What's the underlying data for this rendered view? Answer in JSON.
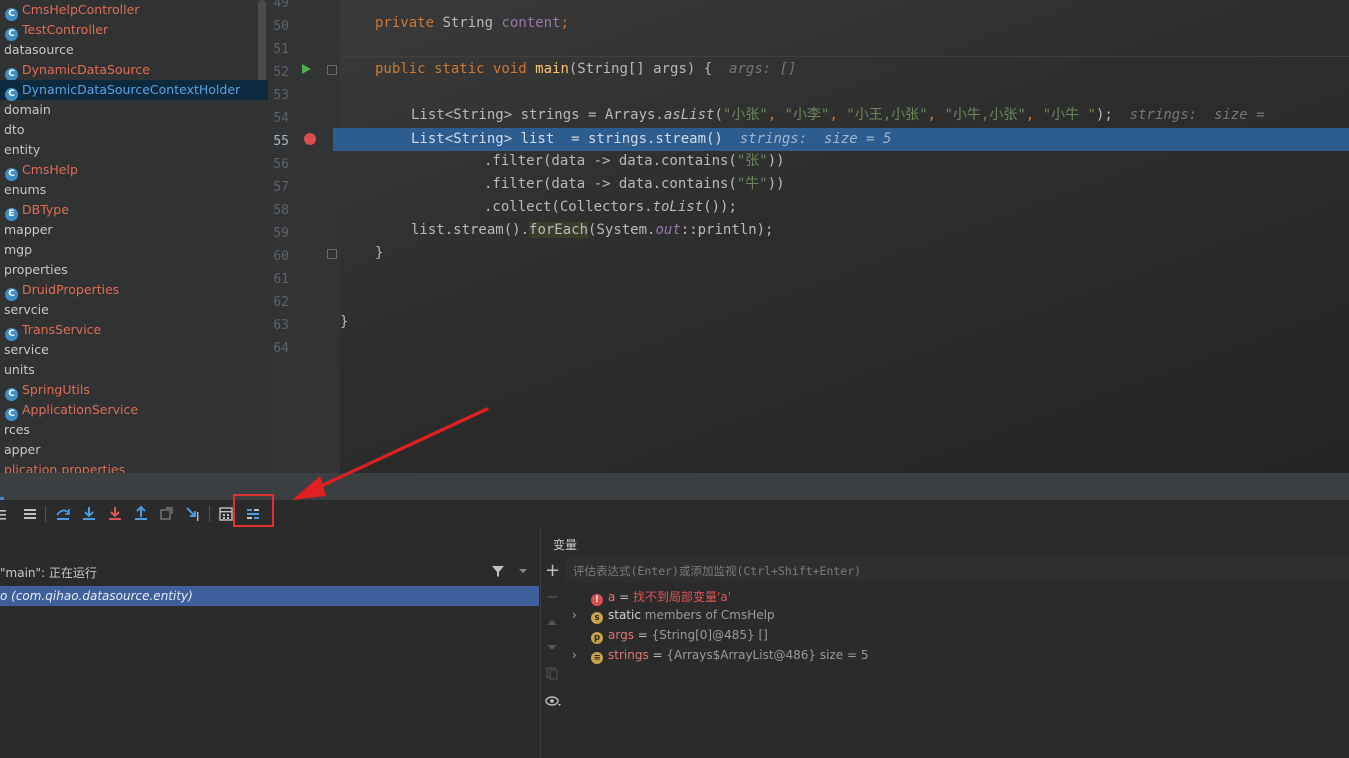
{
  "project_tree": {
    "items": [
      {
        "label": "CmsHelpController",
        "kind": "class",
        "icon": "class-icon"
      },
      {
        "label": "TestController",
        "kind": "class",
        "icon": "class-icon"
      },
      {
        "label": "datasource",
        "kind": "package"
      },
      {
        "label": "DynamicDataSource",
        "kind": "class",
        "icon": "class-icon"
      },
      {
        "label": "DynamicDataSourceContextHolder",
        "kind": "class",
        "icon": "class-icon",
        "selected": true
      },
      {
        "label": "domain",
        "kind": "package"
      },
      {
        "label": "dto",
        "kind": "package"
      },
      {
        "label": "entity",
        "kind": "package"
      },
      {
        "label": "CmsHelp",
        "kind": "class",
        "icon": "runnable-class-icon"
      },
      {
        "label": "enums",
        "kind": "package"
      },
      {
        "label": "DBType",
        "kind": "enum",
        "icon": "enum-icon"
      },
      {
        "label": "mapper",
        "kind": "package"
      },
      {
        "label": "mgp",
        "kind": "package"
      },
      {
        "label": "properties",
        "kind": "package"
      },
      {
        "label": "DruidProperties",
        "kind": "class",
        "icon": "class-icon"
      },
      {
        "label": "servcie",
        "kind": "package"
      },
      {
        "label": "TransService",
        "kind": "class",
        "icon": "class-icon"
      },
      {
        "label": "service",
        "kind": "package"
      },
      {
        "label": "units",
        "kind": "package"
      },
      {
        "label": "SpringUtils",
        "kind": "class",
        "icon": "class-icon"
      },
      {
        "label": "ApplicationService",
        "kind": "class",
        "icon": "class-icon"
      },
      {
        "label": "rces",
        "kind": "package"
      },
      {
        "label": "apper",
        "kind": "package"
      },
      {
        "label": "plication.properties",
        "kind": "file"
      }
    ]
  },
  "editor": {
    "line_numbers": [
      "49",
      "50",
      "51",
      "52",
      "53",
      "54",
      "55",
      "56",
      "57",
      "58",
      "59",
      "60",
      "61",
      "62",
      "63",
      "64"
    ],
    "current_line": "55",
    "code": {
      "l50": {
        "kw": "private",
        "type": " String ",
        "field": "content",
        "end": ";"
      },
      "l52": {
        "kw": "public static void ",
        "name": "main",
        "rest": "(String[] args) {",
        "hint": "args: []"
      },
      "l54": {
        "pre": "List<String> strings = Arrays.",
        "call": "asList",
        "open": "(",
        "s1": "\"小张\"",
        "c1": ", ",
        "s2": "\"小李\"",
        "c2": ", ",
        "s3": "\"小王,小张\"",
        "c3": ", ",
        "s4": "\"小牛,小张\"",
        "c4": ", ",
        "s5": "\"小牛 \"",
        "close": ");",
        "hint": "strings:  size = "
      },
      "l55": {
        "text": "List<String> list  = strings.stream()",
        "hint": "strings:  size = 5"
      },
      "l56": {
        "pre": ".filter(data -> data.contains(",
        "str": "\"张\"",
        "post": "))"
      },
      "l57": {
        "pre": ".filter(data -> data.contains(",
        "str": "\"牛\"",
        "post": "))"
      },
      "l58": {
        "pre": ".collect(Collectors.",
        "call": "toList",
        "post": "());"
      },
      "l59": {
        "pre": "list.stream().",
        "call": "forEach",
        "mid": "(System.",
        "field": "out",
        "post": "::println);"
      },
      "l60": {
        "text": "}"
      },
      "l63": {
        "text": "}"
      }
    }
  },
  "debug_toolbar": {
    "icons": [
      "console-icon",
      "frames-list-icon",
      "step-over-icon",
      "step-into-icon",
      "force-step-into-icon",
      "step-out-icon",
      "drop-frame-icon",
      "run-to-cursor-icon",
      "evaluate-expression-icon",
      "trace-stream-icon"
    ],
    "highlighted": "trace-stream-icon"
  },
  "frames": {
    "thread_label": "\"main\": 正在运行",
    "frame_label": "o (com.qihao.datasource.entity)"
  },
  "variables": {
    "title": "变量",
    "eval_placeholder": "评估表达式(Enter)或添加监视(Ctrl+Shift+Enter)",
    "items": [
      {
        "name": "a",
        "eq": " = ",
        "value": "找不到局部变量'a'",
        "badge": "!",
        "kind": "error"
      },
      {
        "name": "static",
        "value": " members of CmsHelp",
        "badge": "s",
        "kind": "static",
        "expandable": true
      },
      {
        "name": "args",
        "eq": " = ",
        "value": "{String[0]@485} []",
        "badge": "p",
        "kind": "param"
      },
      {
        "name": "strings",
        "eq": " = ",
        "value": "{Arrays$ArrayList@486}  size = 5",
        "badge": "≡",
        "kind": "list",
        "expandable": true
      }
    ]
  },
  "colors": {
    "selection": "#2d5c8f",
    "keyword": "#cc7832",
    "string": "#6a8759",
    "annotation_red": "#e03030"
  }
}
